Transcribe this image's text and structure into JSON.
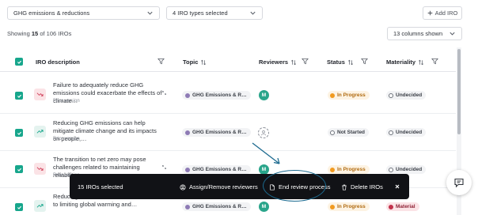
{
  "filters": {
    "topic_filter": "GHG emissions & reductions",
    "type_filter": "4 IRO types selected",
    "add_iro_label": "Add IRO"
  },
  "summary": {
    "showing_prefix": "Showing",
    "showing_count": "15",
    "showing_suffix": "of 106 IROs",
    "columns_select": "13 columns shown"
  },
  "table": {
    "headers": {
      "description": "IRO description",
      "topic": "Topic",
      "reviewers": "Reviewers",
      "status": "Status",
      "materiality": "Materiality"
    },
    "rows": [
      {
        "description": "Failure to adequately reduce GHG emissions could exacerbate the effects of climate…",
        "prior": "Prior version",
        "trend": "negative",
        "topic": "GHG Emissions & R…",
        "reviewer": "M",
        "status": "In Progress",
        "materiality": "Undecided"
      },
      {
        "description": "Reducing GHG emissions can help mitigate climate change and its impacts on people,…",
        "prior": "Prior version",
        "trend": "positive",
        "topic": "GHG Emissions & R…",
        "reviewer": "",
        "status": "Not Started",
        "materiality": "Undecided"
      },
      {
        "description": "The transition to net zero may pose challenges related to maintaining reliabilit…",
        "prior": "Prior version",
        "trend": "negative",
        "topic": "GHG Emissions & R…",
        "reviewer": "M",
        "status": "In Progress",
        "materiality": "Undecided"
      },
      {
        "description": "Reducing GHG emissions can contribute to limiting global warming and…",
        "prior": "",
        "trend": "positive",
        "topic": "GHG Emissions & R…",
        "reviewer": "M",
        "status": "In Progress",
        "materiality": "Material"
      }
    ]
  },
  "action_bar": {
    "selected": "15 IROs selected",
    "assign": "Assign/Remove reviewers",
    "end_review": "End review process",
    "delete": "Delete IROs"
  },
  "colors": {
    "accent": "#17a68c",
    "highlight": "#1c6a8f",
    "action_bar_bg": "#111216"
  },
  "icons": [
    "chevron-down-icon",
    "plus-icon",
    "sort-icon",
    "filter-icon",
    "check-icon",
    "trend-down-icon",
    "trend-up-icon",
    "expand-icon",
    "user-icon",
    "document-icon",
    "trash-icon",
    "close-icon",
    "chat-icon"
  ]
}
